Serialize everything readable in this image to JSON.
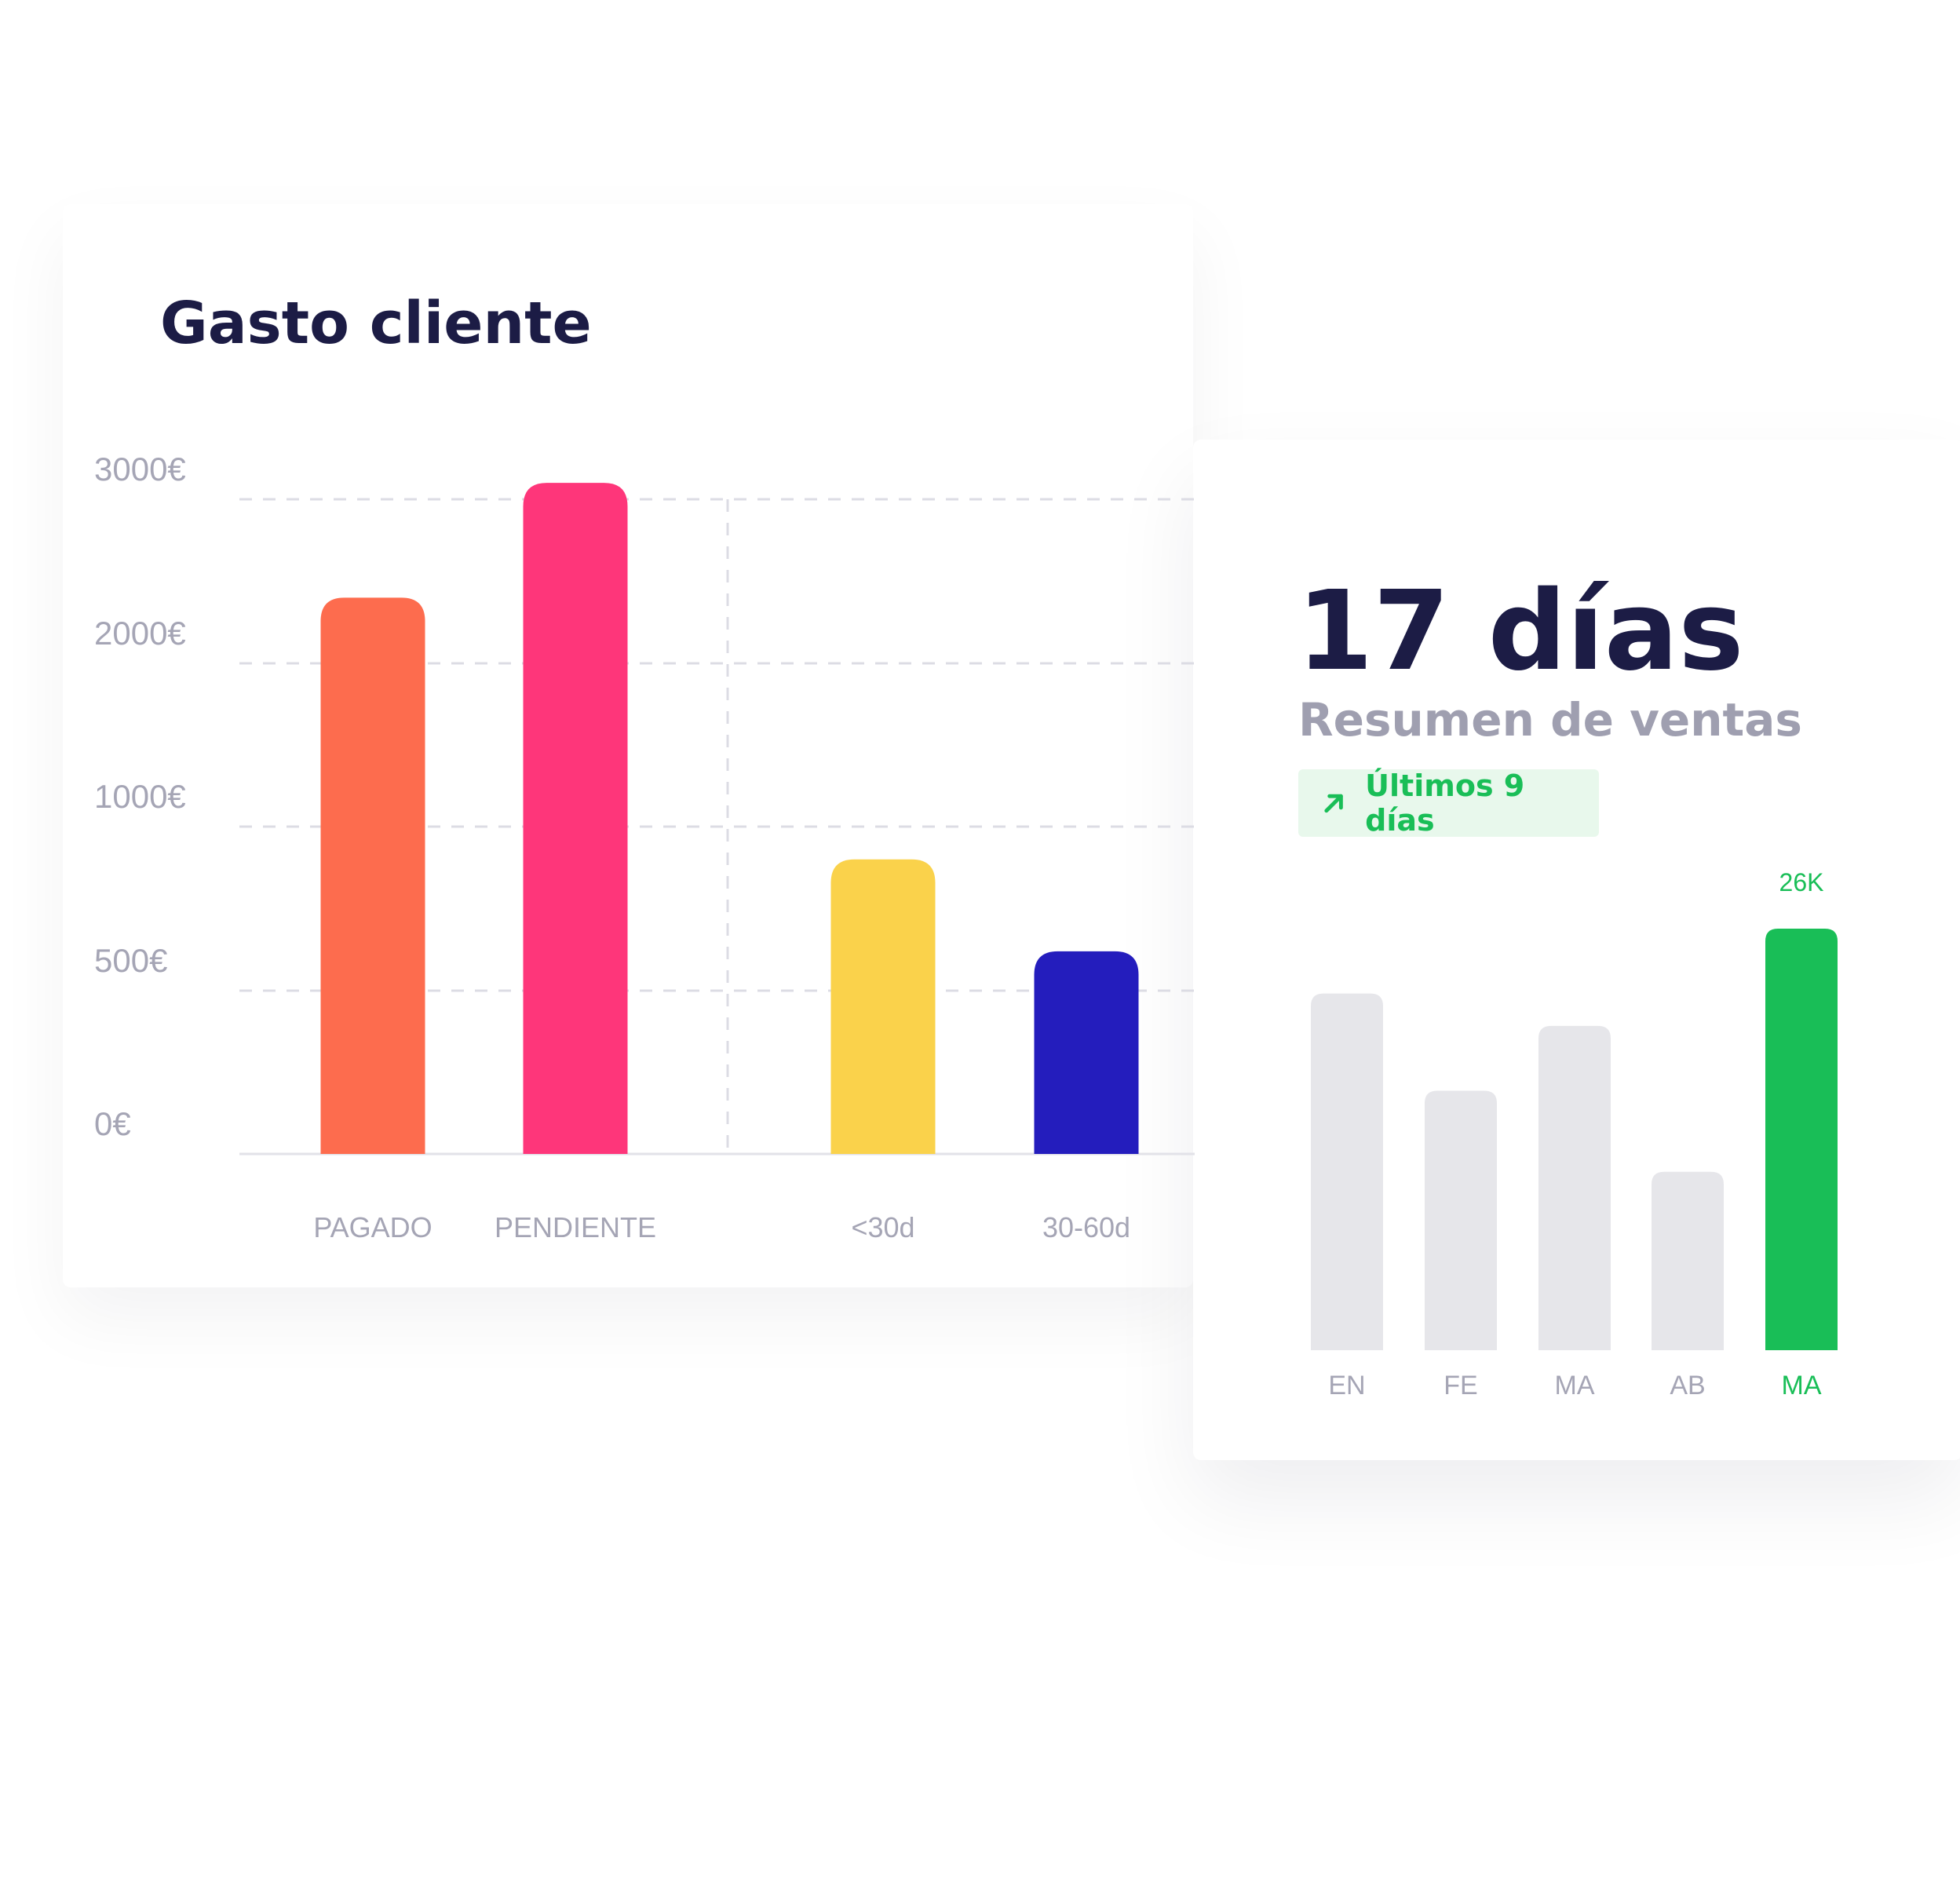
{
  "colors": {
    "title": "#1c1c45",
    "subtitle": "#9f9fb0",
    "tick": "#a5a5b5",
    "grid": "#dcdce4",
    "green": "#19be57",
    "badge_bg": "#e8f8ec",
    "gray_bar": "#e6e6ea"
  },
  "chart_data": [
    {
      "type": "bar",
      "title": "Gasto cliente",
      "categories": [
        "PAGADO",
        "PENDIENTE",
        "<30d",
        "30-60d"
      ],
      "values": [
        2400,
        3100,
        900,
        620
      ],
      "colors": [
        "#fd6c4e",
        "#fe367a",
        "#fad24b",
        "#241dbd"
      ],
      "yticks": [
        {
          "label": "0€",
          "value": 0
        },
        {
          "label": "500€",
          "value": 500
        },
        {
          "label": "1000€",
          "value": 1000
        },
        {
          "label": "2000€",
          "value": 2000
        },
        {
          "label": "3000€",
          "value": 3000
        }
      ],
      "ylim": [
        0,
        3000
      ],
      "grid": true,
      "xlabel": "",
      "ylabel": ""
    },
    {
      "type": "bar",
      "title": "17 días",
      "subtitle": "Resumen de ventas",
      "badge": "Últimos 9 días",
      "badge_icon": "arrow-up-right-icon",
      "categories": [
        "EN",
        "FE",
        "MA",
        "AB",
        "MA"
      ],
      "values": [
        22,
        16,
        20,
        11,
        26
      ],
      "highlight_index": 4,
      "highlight_label": "26K",
      "ylim": [
        0,
        26
      ],
      "grid": false,
      "xlabel": "",
      "ylabel": ""
    }
  ]
}
